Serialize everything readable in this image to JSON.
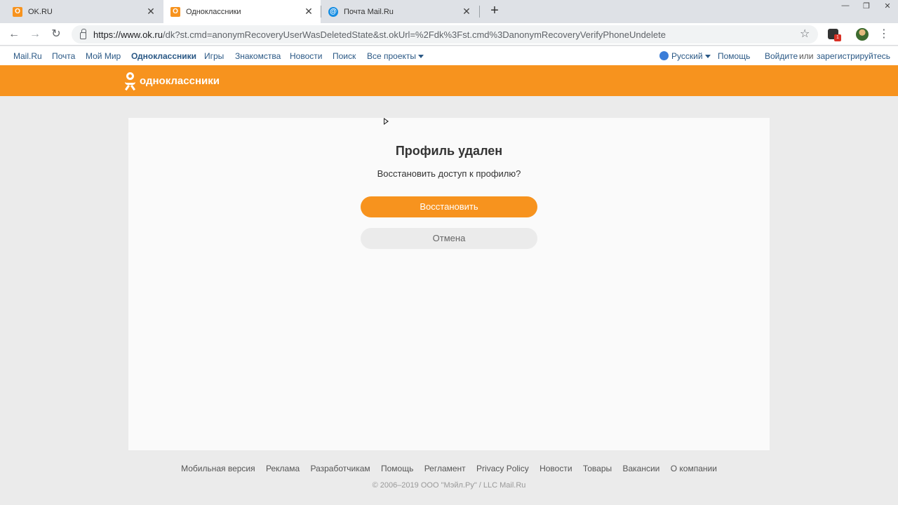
{
  "browser": {
    "tabs": [
      {
        "title": "OK.RU",
        "favicon": "ok-favicon",
        "active": false
      },
      {
        "title": "Одноклассники",
        "favicon": "ok-favicon",
        "active": true
      },
      {
        "title": "Почта Mail.Ru",
        "favicon": "mailru-favicon",
        "active": false
      }
    ],
    "tab_close_glyph": "✕",
    "new_tab_glyph": "+",
    "window_controls": [
      "—",
      "❐",
      "✕"
    ],
    "url_host": "https://www.ok.ru",
    "url_rest": "/dk?st.cmd=anonymRecoveryUserWasDeletedState&st.okUrl=%2Fdk%3Fst.cmd%3DanonymRecoveryVerifyPhoneUndelete",
    "back_glyph": "←",
    "forward_glyph": "→",
    "reload_glyph": "↻",
    "star_glyph": "☆",
    "menu_glyph": "⋮",
    "ext_badge": "1"
  },
  "portal": {
    "links": [
      "Mail.Ru",
      "Почта",
      "Мой Мир",
      "Одноклассники",
      "Игры",
      "Знакомства",
      "Новости",
      "Поиск",
      "Все проекты"
    ],
    "language": "Русский",
    "help": "Помощь",
    "login": "Войдите",
    "or": "или",
    "register": "зарегистрируйтесь"
  },
  "header": {
    "logo_text": "одноклассники",
    "brand_color": "#f7931e"
  },
  "main": {
    "title": "Профиль удален",
    "question": "Восстановить доступ к профилю?",
    "restore_label": "Восстановить",
    "cancel_label": "Отмена"
  },
  "footer": {
    "links": [
      "Мобильная версия",
      "Реклама",
      "Разработчикам",
      "Помощь",
      "Регламент",
      "Privacy Policy",
      "Новости",
      "Товары",
      "Вакансии",
      "О компании"
    ],
    "copyright": "© 2006–2019 ООО \"Мэйл.Ру\" / LLC Mail.Ru"
  }
}
